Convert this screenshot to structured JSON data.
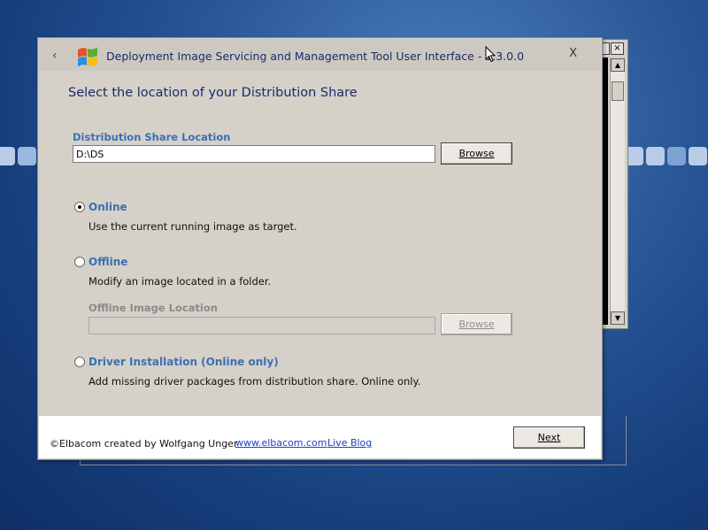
{
  "dialog": {
    "title": "Deployment Image Servicing and Management Tool User Interface   -  1.3.0.0",
    "back_symbol": "‹",
    "close_symbol": "X",
    "heading": "Select the location of your Distribution Share"
  },
  "distribution_share": {
    "label": "Distribution Share Location",
    "value": "D:\\DS",
    "browse_label": "Browse"
  },
  "options": {
    "online": {
      "title": "Online",
      "description": "Use the current running image as target.",
      "selected": true
    },
    "offline": {
      "title": "Offline",
      "description": "Modify an image located in a folder.",
      "selected": false,
      "location_label": "Offline Image Location",
      "location_value": "",
      "browse_label": "Browse"
    },
    "driver": {
      "title": "Driver Installation (Online only)",
      "description": "Add missing driver packages from distribution share. Online only.",
      "selected": false
    }
  },
  "footer": {
    "copyright": "©Elbacom created by Wolfgang Unger",
    "link_website": "www.elbacom.com",
    "link_blog": "Live Blog",
    "next_label": "Next"
  },
  "background_console": {
    "close_symbol": "×"
  },
  "icons": {
    "app_logo": "windows-flag-icon",
    "back": "chevron-left-icon",
    "close": "close-icon",
    "cursor": "mouse-pointer-icon"
  },
  "colors": {
    "accent_blue": "#3d6fb3",
    "title_navy": "#1c2a6a",
    "dialog_bg": "#d5d1c9",
    "link_blue": "#1f3fbf"
  }
}
